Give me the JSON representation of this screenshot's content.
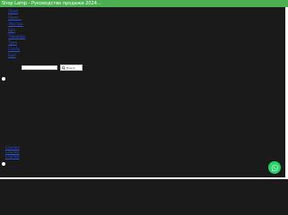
{
  "window": {
    "title": "Shop Lamp - Руководство продажи 2024..."
  },
  "nav": {
    "items": [
      {
        "label": "Ламп"
      },
      {
        "label": "Ламп..."
      },
      {
        "label": "Люстры"
      },
      {
        "label": "Бра"
      },
      {
        "label": "Торшеры"
      },
      {
        "label": "Трек"
      },
      {
        "label": "Споты"
      },
      {
        "label": "Ещё"
      }
    ]
  },
  "search": {
    "placeholder": "",
    "button_label": "Поиск"
  },
  "sidebar": {
    "links": [
      {
        "label": "Ссылка"
      },
      {
        "label": "Ссылка"
      },
      {
        "label": "Ссылка"
      }
    ]
  },
  "floating": {
    "whatsapp_icon": "whatsapp-icon"
  },
  "colors": {
    "topbar": "#4caf50",
    "whatsapp": "#25d366",
    "background": "#1a1a1a"
  }
}
